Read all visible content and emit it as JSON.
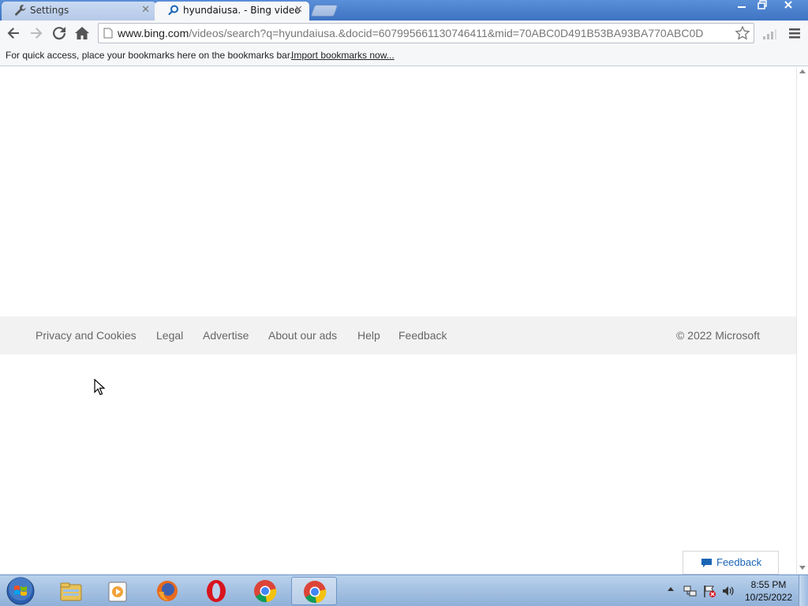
{
  "browser": {
    "tabs": [
      {
        "title": "Settings",
        "icon": "wrench-icon",
        "active": false
      },
      {
        "title": "hyundaiusa. - Bing video",
        "icon": "search-icon",
        "active": true
      }
    ],
    "address": {
      "host": "www.bing.com",
      "path": "/videos/search?q=hyundaiusa.&docid=607995661130746411&mid=70ABC0D491B53BA93BA770ABC0D"
    },
    "bookmarks_bar": {
      "message": "For quick access, place your bookmarks here on the bookmarks bar.",
      "import_link": "Import bookmarks now..."
    }
  },
  "page": {
    "footer": {
      "links": [
        "Privacy and Cookies",
        "Legal",
        "Advertise",
        "About our ads",
        "Help",
        "Feedback"
      ],
      "copyright": "© 2022 Microsoft"
    },
    "feedback_button": "Feedback"
  },
  "taskbar": {
    "apps": [
      "windows-explorer",
      "media-player",
      "firefox",
      "opera",
      "chrome",
      "chrome"
    ],
    "clock": {
      "time": "8:55 PM",
      "date": "10/25/2022"
    }
  },
  "colors": {
    "titlebar": "#4a80cc",
    "link_blue": "#1a64b4",
    "footer_bg": "#f2f2f2",
    "footer_text": "#666666"
  }
}
